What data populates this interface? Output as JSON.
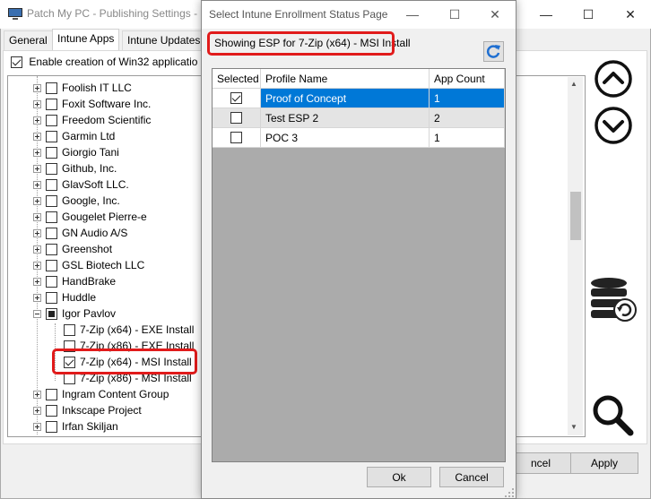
{
  "main_window": {
    "title": "Patch My PC - Publishing Settings - (",
    "controls": [
      "—",
      "☐",
      "✕"
    ],
    "tabs": [
      "General",
      "Intune Apps",
      "Intune Updates"
    ],
    "enable_label": "Enable creation of Win32 applicatio",
    "tree": [
      {
        "label": "Foolish IT LLC",
        "expander": "plus",
        "check": "none",
        "level": 0
      },
      {
        "label": "Foxit Software Inc.",
        "expander": "plus",
        "check": "none",
        "level": 0
      },
      {
        "label": "Freedom Scientific",
        "expander": "plus",
        "check": "none",
        "level": 0
      },
      {
        "label": "Garmin Ltd",
        "expander": "plus",
        "check": "none",
        "level": 0
      },
      {
        "label": "Giorgio Tani",
        "expander": "plus",
        "check": "none",
        "level": 0
      },
      {
        "label": "Github, Inc.",
        "expander": "plus",
        "check": "none",
        "level": 0
      },
      {
        "label": "GlavSoft LLC.",
        "expander": "plus",
        "check": "none",
        "level": 0
      },
      {
        "label": "Google, Inc.",
        "expander": "plus",
        "check": "none",
        "level": 0
      },
      {
        "label": "Gougelet Pierre-e",
        "expander": "plus",
        "check": "none",
        "level": 0
      },
      {
        "label": "GN Audio A/S",
        "expander": "plus",
        "check": "none",
        "level": 0
      },
      {
        "label": "Greenshot",
        "expander": "plus",
        "check": "none",
        "level": 0
      },
      {
        "label": "GSL Biotech LLC",
        "expander": "plus",
        "check": "none",
        "level": 0
      },
      {
        "label": "HandBrake",
        "expander": "plus",
        "check": "none",
        "level": 0
      },
      {
        "label": "Huddle",
        "expander": "plus",
        "check": "none",
        "level": 0
      },
      {
        "label": "Igor Pavlov",
        "expander": "minus",
        "check": "partial",
        "level": 0
      },
      {
        "label": "7-Zip (x64) - EXE Install",
        "expander": "",
        "check": "none",
        "level": 1
      },
      {
        "label": "7-Zip (x86) - EXE Install",
        "expander": "",
        "check": "none",
        "level": 1
      },
      {
        "label": "7-Zip (x64) - MSI Install",
        "expander": "",
        "check": "checked",
        "level": 1
      },
      {
        "label": "7-Zip (x86) - MSI Install",
        "expander": "",
        "check": "none",
        "level": 1
      },
      {
        "label": "Ingram Content Group",
        "expander": "plus",
        "check": "none",
        "level": 0
      },
      {
        "label": "Inkscape Project",
        "expander": "plus",
        "check": "none",
        "level": 0
      },
      {
        "label": "Irfan Skiljan",
        "expander": "plus",
        "check": "none",
        "level": 0
      }
    ],
    "cancel_label": "ncel",
    "apply_label": "Apply"
  },
  "dialog": {
    "title": "Select Intune Enrollment Status Page",
    "controls": [
      "—",
      "☐",
      "✕"
    ],
    "heading": "Showing ESP for 7-Zip (x64) - MSI Install",
    "columns": [
      "Selected",
      "Profile Name",
      "App Count"
    ],
    "rows": [
      {
        "selected": true,
        "name": "Proof of Concept",
        "count": "1",
        "highlight": true
      },
      {
        "selected": false,
        "name": "Test ESP 2",
        "count": "2",
        "highlight": false
      },
      {
        "selected": false,
        "name": "POC 3",
        "count": "1",
        "highlight": false
      }
    ],
    "ok_label": "Ok",
    "cancel_label": "Cancel"
  },
  "colors": {
    "selection_blue": "#0078d7",
    "highlight_red": "#e11b1b"
  },
  "icons": [
    "app-icon",
    "arrow-up-circle-icon",
    "arrow-down-circle-icon",
    "database-refresh-icon",
    "magnifier-icon",
    "refresh-icon"
  ]
}
